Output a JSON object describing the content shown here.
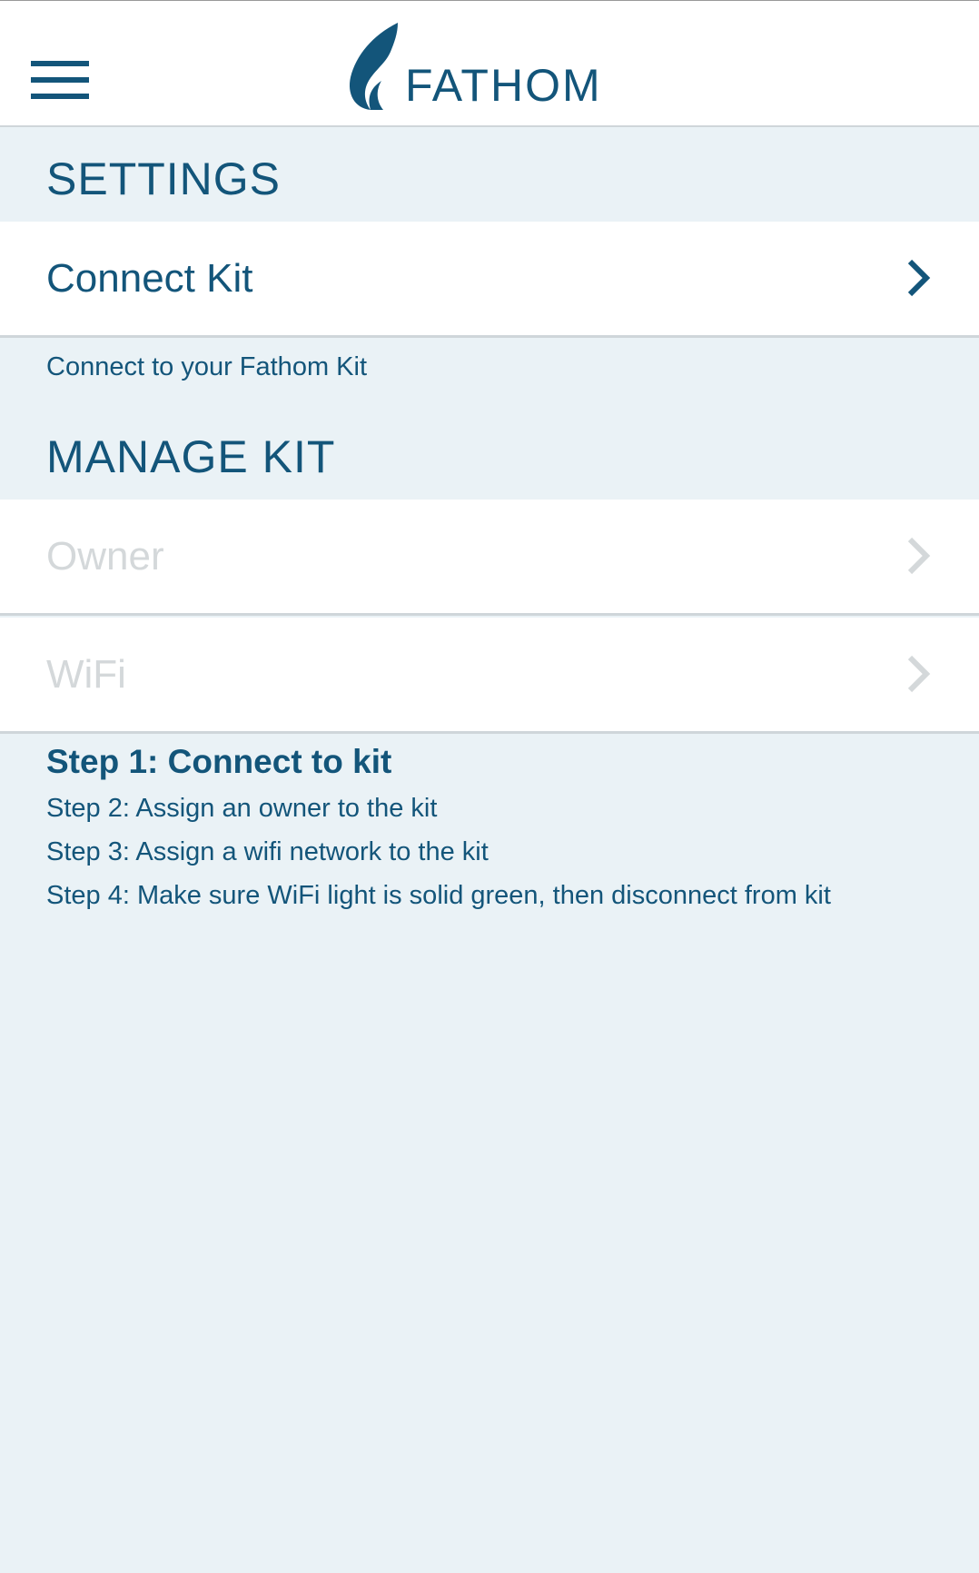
{
  "header": {
    "brand": "FATHOM",
    "menu_icon": "hamburger-menu-icon",
    "logo_icon": "fathom-leaf-logo-icon"
  },
  "settings": {
    "title": "SETTINGS",
    "items": [
      {
        "label": "Connect Kit",
        "enabled": true,
        "icon": "chevron-right-icon"
      }
    ],
    "hint": "Connect to your Fathom Kit"
  },
  "manage_kit": {
    "title": "MANAGE KIT",
    "items": [
      {
        "label": "Owner",
        "enabled": false,
        "icon": "chevron-right-icon"
      },
      {
        "label": "WiFi",
        "enabled": false,
        "icon": "chevron-right-icon"
      }
    ]
  },
  "steps": [
    {
      "text": "Step 1: Connect to kit",
      "active": true
    },
    {
      "text": "Step 2: Assign an owner to the kit",
      "active": false
    },
    {
      "text": "Step 3: Assign a wifi network to the kit",
      "active": false
    },
    {
      "text": "Step 4: Make sure WiFi light is solid green, then disconnect from kit",
      "active": false
    }
  ],
  "colors": {
    "brand": "#13557a",
    "background": "#eaf2f6",
    "row": "#ffffff",
    "disabled_text": "#d4d8da",
    "divider": "#cfd6da"
  }
}
